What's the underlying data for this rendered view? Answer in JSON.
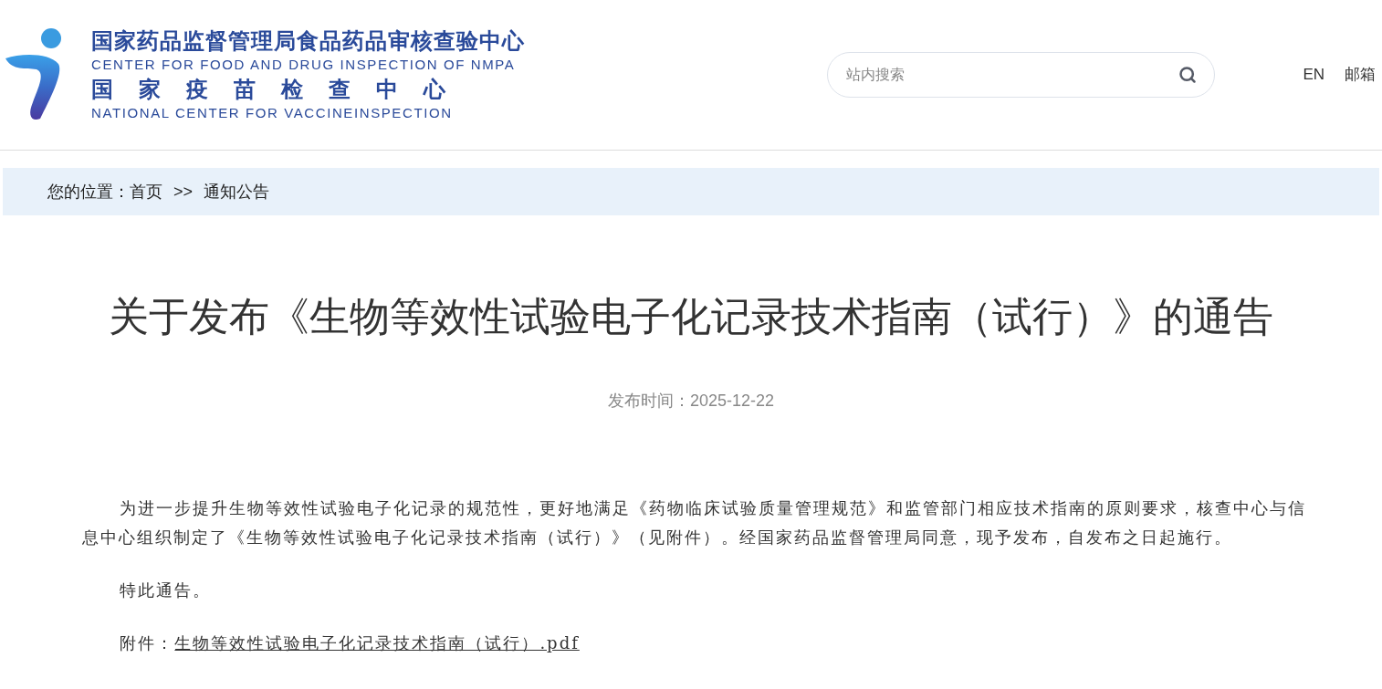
{
  "header": {
    "logo": {
      "title_cn": "国家药品监督管理局食品药品审核查验中心",
      "title_en": "CENTER FOR FOOD AND DRUG INSPECTION OF NMPA",
      "subtitle_cn": "国家疫苗检查中心",
      "subtitle_en": "NATIONAL CENTER FOR VACCINEINSPECTION"
    },
    "search": {
      "placeholder": "站内搜索"
    },
    "links": [
      "EN",
      "邮箱"
    ]
  },
  "breadcrumb": {
    "label": "您的位置：",
    "items": [
      "首页",
      "通知公告"
    ],
    "separator": ">>"
  },
  "article": {
    "title": "关于发布《生物等效性试验电子化记录技术指南（试行）》的通告",
    "date_label": "发布时间：",
    "date": "2025-12-22",
    "paragraphs": [
      "为进一步提升生物等效性试验电子化记录的规范性，更好地满足《药物临床试验质量管理规范》和监管部门相应技术指南的原则要求，核查中心与信息中心组织制定了《生物等效性试验电子化记录技术指南（试行）》（见附件）。经国家药品监督管理局同意，现予发布，自发布之日起施行。",
      "特此通告。"
    ],
    "attachment": {
      "label": "附件：",
      "file": "生物等效性试验电子化记录技术指南（试行）.pdf"
    }
  }
}
